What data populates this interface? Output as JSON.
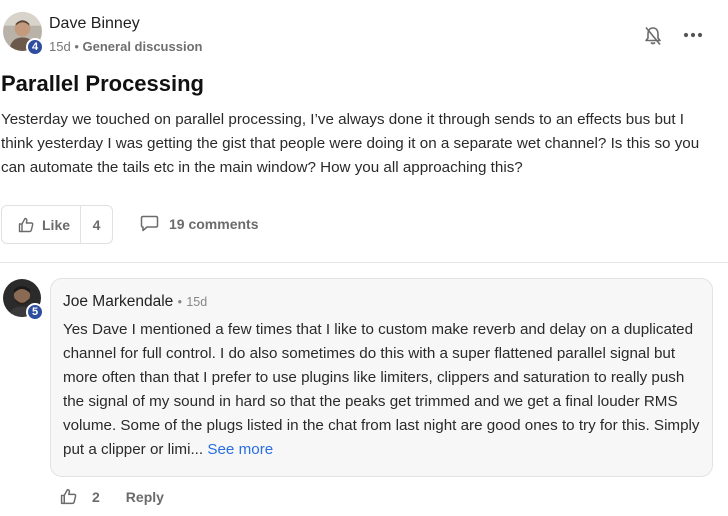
{
  "post": {
    "author": "Dave Binney",
    "level": "4",
    "age": "15d",
    "separator": "•",
    "category": "General discussion",
    "title": "Parallel Processing",
    "body": "Yesterday we touched on parallel processing, I’ve always done it through sends to an effects bus but I think yesterday I was getting the gist that people were doing it on a separate wet channel? Is this so you can automate the tails etc in the main window? How you all approaching this?",
    "like_label": "Like",
    "like_count": "4",
    "comments_label": "19 comments"
  },
  "comment": {
    "author": "Joe Markendale",
    "level": "5",
    "separator": "•",
    "age": "15d",
    "text": "Yes Dave I mentioned a few times that I like to custom make reverb and delay on a duplicated channel for full control. I do also sometimes do this with a super flattened parallel signal but more often than that I prefer to use plugins like limiters, clippers and saturation to really push the signal of my sound in hard so that the peaks get trimmed and we get a final louder RMS volume. Some of the plugs listed in the chat from last night are good ones to try for this. Simply put a clipper or limi...",
    "see_more": "See more",
    "like_count": "2",
    "reply_label": "Reply"
  },
  "icons": {
    "bell": "bell-off-icon",
    "more": "more-horizontal-icon",
    "like": "thumbs-up-icon",
    "comment": "comment-bubble-icon"
  },
  "colors": {
    "level_badge": "#2f4ea0",
    "link": "#2a6fe0",
    "muted": "#6b6b6b"
  }
}
